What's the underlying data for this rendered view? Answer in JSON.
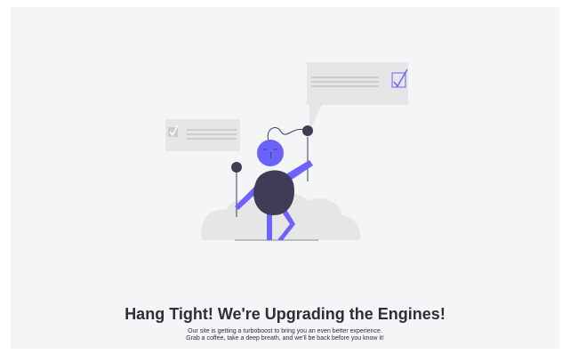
{
  "maintenance": {
    "heading": "Hang Tight! We're Upgrading the Engines!",
    "message_line1": "Our site is getting a turboboost to bring you an even better experience.",
    "message_line2": "Grab a coffee, take a deep breath, and we'll be back before you know it!"
  },
  "colors": {
    "background": "#f4f5f7",
    "accent": "#6c63ff",
    "figure_dark": "#3f3d56",
    "card": "#e6e6e6",
    "card_lines": "#cccccc"
  },
  "illustration": {
    "icons": [
      "checkbox-checked-icon",
      "checkbox-checked-icon"
    ]
  }
}
